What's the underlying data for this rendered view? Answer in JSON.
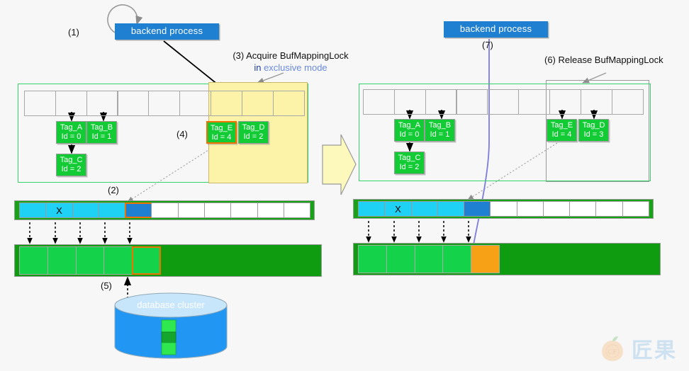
{
  "left": {
    "step1": "(1)",
    "process_label": "backend process",
    "step3_line1": "(3) Acquire BufMappingLock",
    "step3_in": "in",
    "step3_mode": "exclusive mode",
    "step4": "(4)",
    "step2": "(2)",
    "step5": "(5)",
    "buckets": [
      "",
      "",
      "",
      "",
      "",
      "",
      "",
      "",
      ""
    ],
    "tags": [
      {
        "name": "Tag_A",
        "id": "Id = 0",
        "selected": false
      },
      {
        "name": "Tag_B",
        "id": "Id = 1",
        "selected": false
      },
      {
        "name": "Tag_C",
        "id": "Id = 2",
        "selected": false
      },
      {
        "name": "Tag_E",
        "id": "Id = 4",
        "selected": true
      },
      {
        "name": "Tag_D",
        "id": "Id = 2",
        "selected": false
      }
    ],
    "descriptors": [
      {
        "state": "used",
        "mark": ""
      },
      {
        "state": "used",
        "mark": "X"
      },
      {
        "state": "used",
        "mark": ""
      },
      {
        "state": "used",
        "mark": ""
      },
      {
        "state": "active",
        "mark": "",
        "ring": true
      },
      {
        "state": "free",
        "mark": ""
      },
      {
        "state": "free",
        "mark": ""
      },
      {
        "state": "free",
        "mark": ""
      },
      {
        "state": "free",
        "mark": ""
      },
      {
        "state": "free",
        "mark": ""
      },
      {
        "state": "free",
        "mark": ""
      }
    ],
    "pool": [
      {
        "state": "free"
      },
      {
        "state": "free"
      },
      {
        "state": "free"
      },
      {
        "state": "free"
      },
      {
        "state": "selected"
      }
    ],
    "db_label": "database cluster"
  },
  "right": {
    "process_label": "backend process",
    "step7": "(7)",
    "step6": "(6) Release BufMappingLock",
    "buckets": [
      "",
      "",
      "",
      "",
      "",
      "",
      "",
      "",
      ""
    ],
    "tags": [
      {
        "name": "Tag_A",
        "id": "Id = 0",
        "selected": false
      },
      {
        "name": "Tag_B",
        "id": "Id = 1",
        "selected": false
      },
      {
        "name": "Tag_C",
        "id": "Id = 2",
        "selected": false
      },
      {
        "name": "Tag_E",
        "id": "Id = 4",
        "selected": false
      },
      {
        "name": "Tag_D",
        "id": "Id = 3",
        "selected": false
      }
    ],
    "descriptors": [
      {
        "state": "used",
        "mark": ""
      },
      {
        "state": "used",
        "mark": "X"
      },
      {
        "state": "used",
        "mark": ""
      },
      {
        "state": "used",
        "mark": ""
      },
      {
        "state": "active",
        "mark": "",
        "ring": false
      },
      {
        "state": "free",
        "mark": ""
      },
      {
        "state": "free",
        "mark": ""
      },
      {
        "state": "free",
        "mark": ""
      },
      {
        "state": "free",
        "mark": ""
      },
      {
        "state": "free",
        "mark": ""
      },
      {
        "state": "free",
        "mark": ""
      }
    ],
    "pool": [
      {
        "state": "free"
      },
      {
        "state": "free"
      },
      {
        "state": "free"
      },
      {
        "state": "free"
      },
      {
        "state": "loaded"
      }
    ]
  },
  "watermark": {
    "text": "匠果",
    "mark": "CF"
  },
  "colors": {
    "process_blue": "#1f7fd0",
    "tag_green": "#13cc35",
    "lock_yellow": "#fdf3a8",
    "highlight_orange": "#f07000",
    "descriptor_cyan": "#1fd2f5",
    "pool_green": "#14d24a",
    "loaded_orange": "#f7a216",
    "strip_green": "#16a416",
    "table_border_green": "#33d46a",
    "db_blue": "#2196f3",
    "link_blue": "#6a8ae0"
  }
}
